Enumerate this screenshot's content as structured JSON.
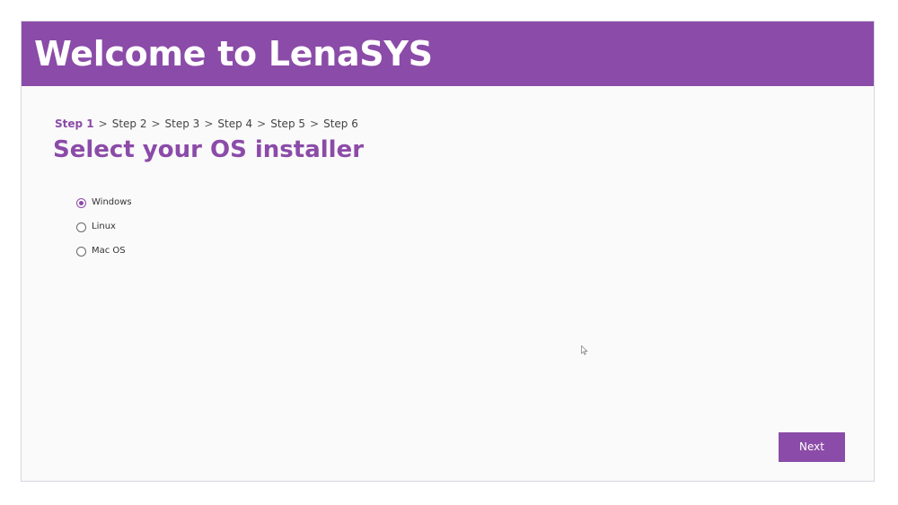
{
  "header": {
    "title_lead": "Welcome to",
    "title_brand": "LenaSYS",
    "background_color": "#8b4ba8"
  },
  "breadcrumb": {
    "steps": [
      "Step 1",
      "Step 2",
      "Step 3",
      "Step 4",
      "Step 5",
      "Step 6"
    ],
    "separator": ">",
    "current_index": 0
  },
  "page": {
    "title": "Select your OS installer"
  },
  "os_options": {
    "items": [
      "Windows",
      "Linux",
      "Mac OS"
    ],
    "selected": "Windows"
  },
  "footer": {
    "next_label": "Next"
  },
  "icons": {
    "cursor": "mouse-pointer-icon"
  },
  "colors": {
    "accent": "#8b4ba8"
  }
}
